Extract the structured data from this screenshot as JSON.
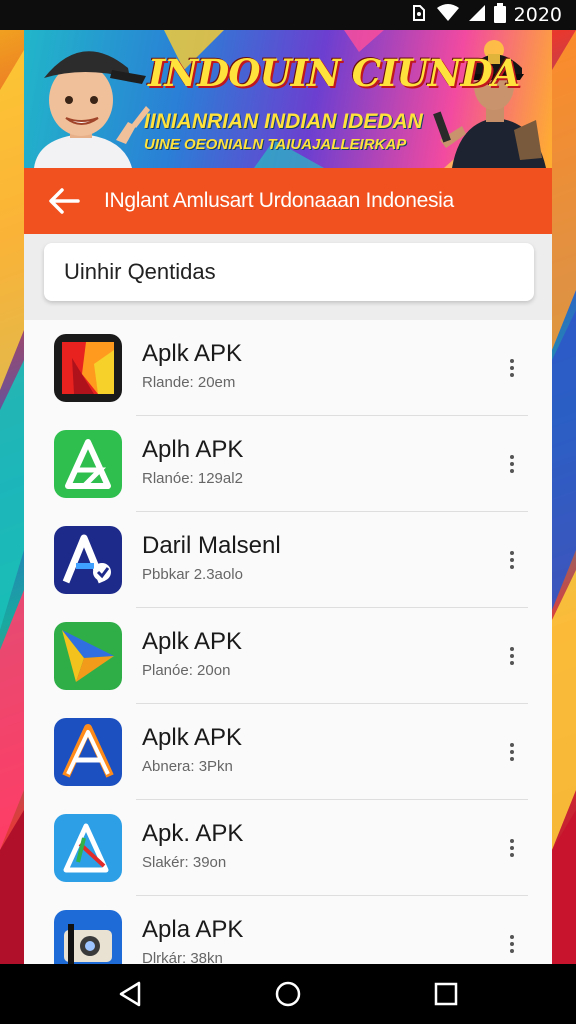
{
  "status_bar": {
    "time": "2020"
  },
  "banner": {
    "title": "INDOUIN CIUNDA",
    "line1": "IINIANRIAN INDIAN IDEDAN",
    "line2": "UINE OEONIALN TAIUAJALLEIRKAP"
  },
  "app_bar": {
    "title": "INglant Amlusart Urdonaaan Indonesia"
  },
  "search": {
    "value": "Uinhir Qentidas"
  },
  "apps": [
    {
      "title": "Aplk APK",
      "subtitle": "Rlande: 20em"
    },
    {
      "title": "Aplh APK",
      "subtitle": "Rlanóe: 129al2"
    },
    {
      "title": "Daril Malsenl",
      "subtitle": "Pbbkar 2.3aolo"
    },
    {
      "title": "Aplk APK",
      "subtitle": "Planóe: 20on"
    },
    {
      "title": "Aplk APK",
      "subtitle": "Abnera: 3Pkn"
    },
    {
      "title": "Apk. APK",
      "subtitle": "Slakér: 39on"
    },
    {
      "title": "Apla APK",
      "subtitle": "Dlrkár: 38kn"
    }
  ],
  "colors": {
    "app_bar": "#f0511e",
    "banner_title": "#ffe23b"
  }
}
